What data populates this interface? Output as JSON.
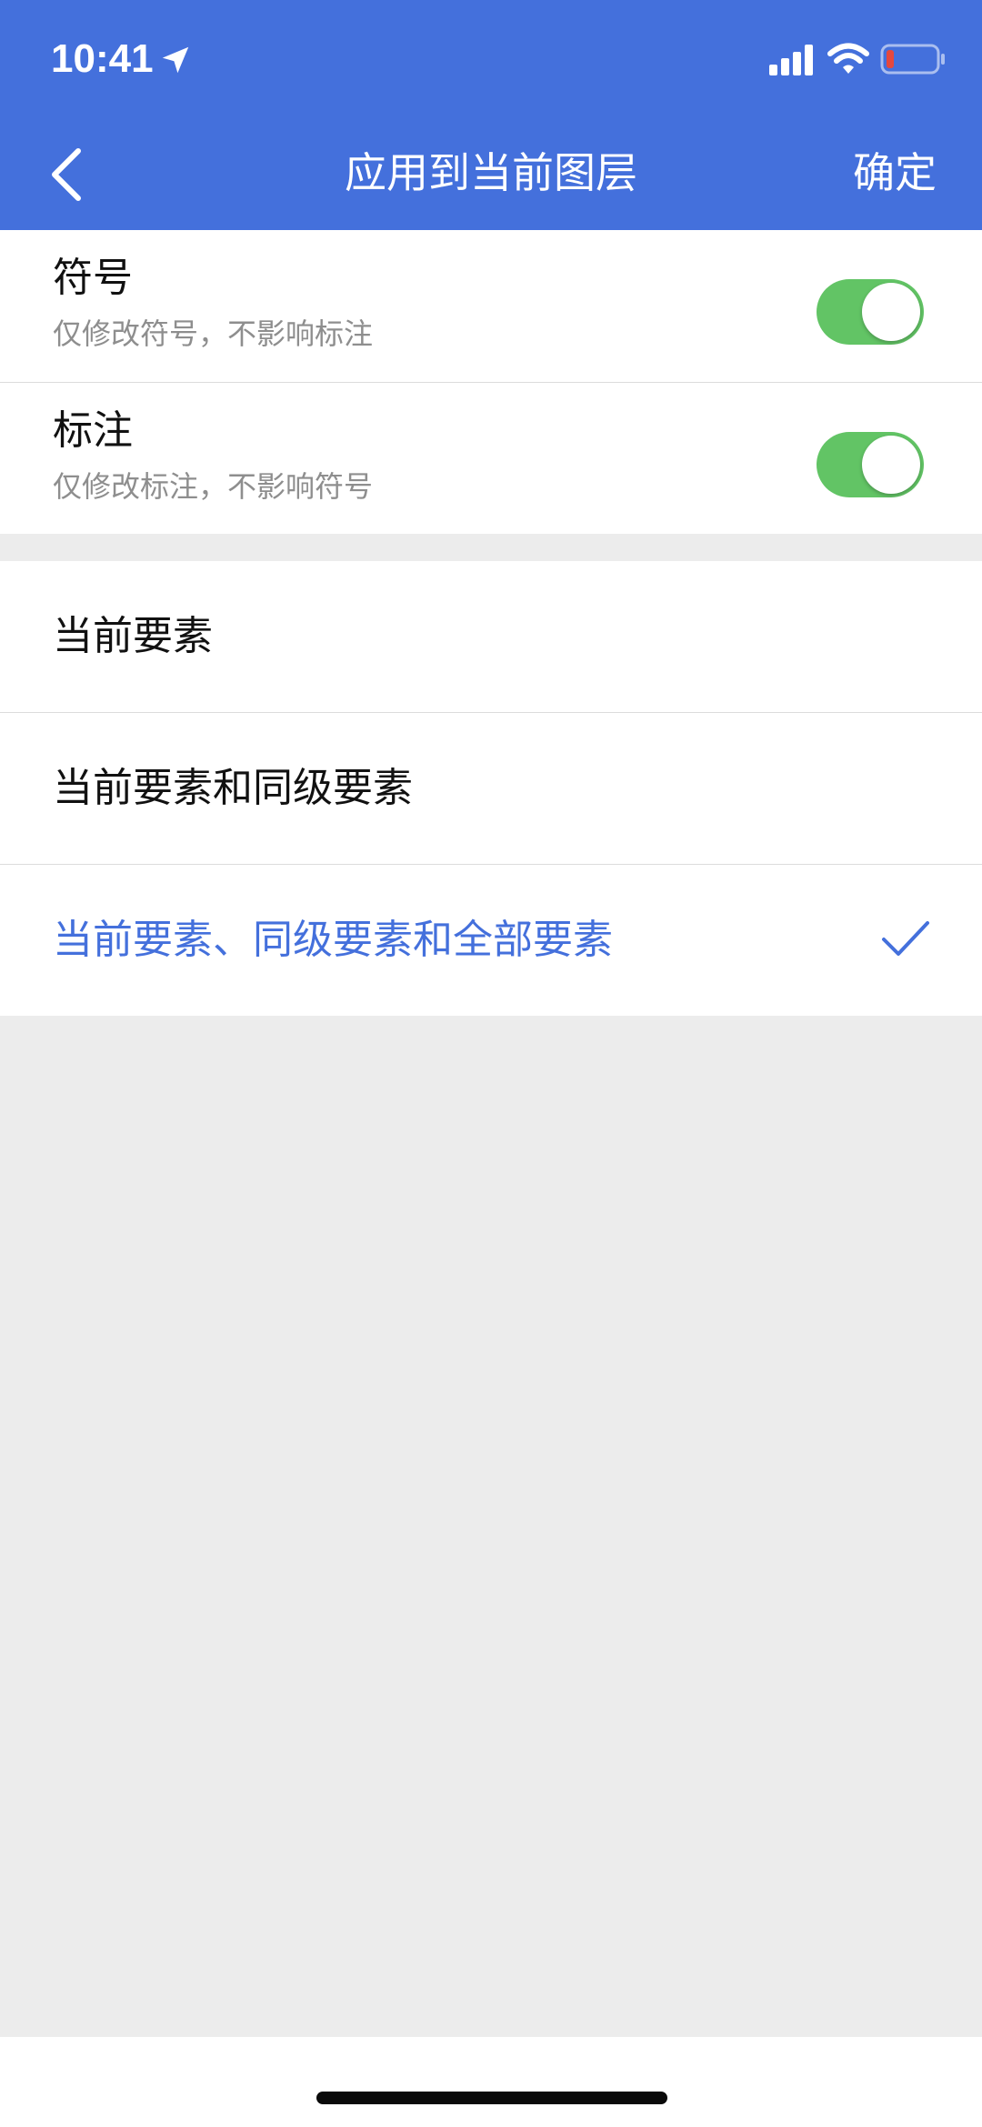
{
  "status_bar": {
    "time": "10:41",
    "icons": [
      "location-arrow-icon",
      "signal-icon",
      "wifi-icon",
      "battery-icon"
    ]
  },
  "nav": {
    "title": "应用到当前图层",
    "confirm_label": "确定",
    "back_icon": "chevron-left-icon"
  },
  "toggles": [
    {
      "title": "符号",
      "subtitle": "仅修改符号，不影响标注",
      "on": true
    },
    {
      "title": "标注",
      "subtitle": "仅修改标注，不影响符号",
      "on": true
    }
  ],
  "options": [
    {
      "label": "当前要素",
      "selected": false
    },
    {
      "label": "当前要素和同级要素",
      "selected": false
    },
    {
      "label": "当前要素、同级要素和全部要素",
      "selected": true
    }
  ],
  "colors": {
    "header": "#4470dc",
    "accent": "#4470dc",
    "switch_on": "#62c465",
    "background": "#ececec",
    "battery_low": "#e5483f"
  }
}
